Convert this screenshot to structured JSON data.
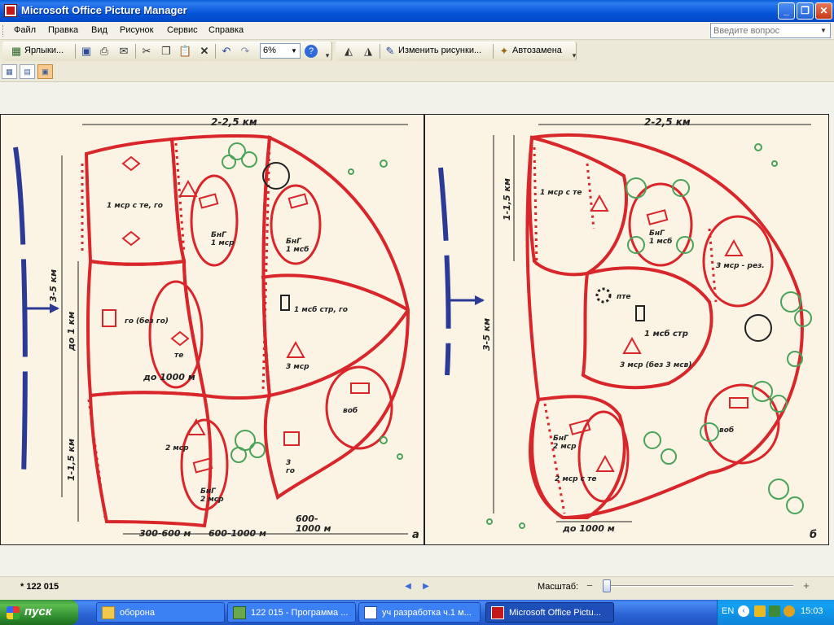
{
  "window": {
    "title": "Microsoft Office Picture Manager",
    "minimize_label": "_",
    "maximize_label": "❐",
    "close_label": "✕"
  },
  "menu": {
    "items": [
      "Файл",
      "Правка",
      "Вид",
      "Рисунок",
      "Сервис",
      "Справка"
    ],
    "ask_placeholder": "Введите вопрос",
    "ask_dropdown": "▼"
  },
  "toolbar": {
    "shortcuts_label": "Ярлыки...",
    "zoom_value": "6%",
    "zoom_dropdown": "▼",
    "edit_pictures_label": "Изменить рисунки...",
    "autocorrect_label": "Автозамена",
    "icons": [
      "save-icon",
      "print-icon",
      "email-icon",
      "cut-icon",
      "copy-icon",
      "paste-icon",
      "delete-icon",
      "undo-icon",
      "redo-icon",
      "help-icon",
      "rotate-left-icon",
      "rotate-right-icon"
    ]
  },
  "views": [
    "thumbnail-view",
    "filmstrip-view",
    "single-picture-view"
  ],
  "picture": {
    "labels_a": {
      "width_top": "2-2,5 км",
      "depth": "3-5 км",
      "to_1km": "до 1 км",
      "to_1000m_mid": "до 1000 м",
      "range_1_15": "1-1,5 км",
      "bottom_1": "300-600 м",
      "bottom_2": "600-1000 м",
      "bottom_3": "600-\n1000 м",
      "unit_1": "1 мср с те, го",
      "unit_2": "БнГ\n1 мср",
      "unit_3": "БнГ\n1 мсб",
      "unit_4": "1 мсб стр, го",
      "unit_5": "го (без го)",
      "unit_6": "те",
      "unit_7": "3 мср",
      "unit_8": "2 мср",
      "unit_9": "БнГ\n2 мср",
      "unit_10": "воб",
      "unit_11": "3\nго",
      "letter": "а"
    },
    "labels_b": {
      "width_top": "2-2,5 км",
      "depth": "3-5 км",
      "range_1_15": "1-1,5 км",
      "to_1000m": "до 1000 м",
      "unit_1": "1 мср с те",
      "unit_2": "БнГ\n1 мсб",
      "unit_3": "3 мср - рез.",
      "unit_4": "пте",
      "unit_5": "1 мсб стр",
      "unit_6": "3 мср (без 3 мсв)",
      "unit_7": "БнГ\n2 мср",
      "unit_8": "2 мср с те",
      "unit_9": "воб",
      "letter": "б"
    }
  },
  "status": {
    "file_name": "* 122 015",
    "zoom_label": "Масштаб:",
    "prev_label": "◀",
    "next_label": "▶",
    "zoom_out_label": "−",
    "zoom_in_label": "+",
    "zoom_slider_fraction": 0.0
  },
  "taskbar": {
    "start_label": "пуск",
    "tasks": [
      {
        "label": "оборона",
        "active": false
      },
      {
        "label": "122 015 - Программа ...",
        "active": false
      },
      {
        "label": "уч разработка ч.1 м...",
        "active": false
      },
      {
        "label": "Microsoft Office Pictu...",
        "active": true
      }
    ],
    "lang": "EN",
    "time": "15:03"
  },
  "colors": {
    "titlebar": "#0455d8",
    "taskbar": "#2a63d4",
    "start": "#3c9a3c",
    "map_red": "#d8262b",
    "map_blue": "#2b3a94",
    "map_green": "#4aa35a"
  }
}
